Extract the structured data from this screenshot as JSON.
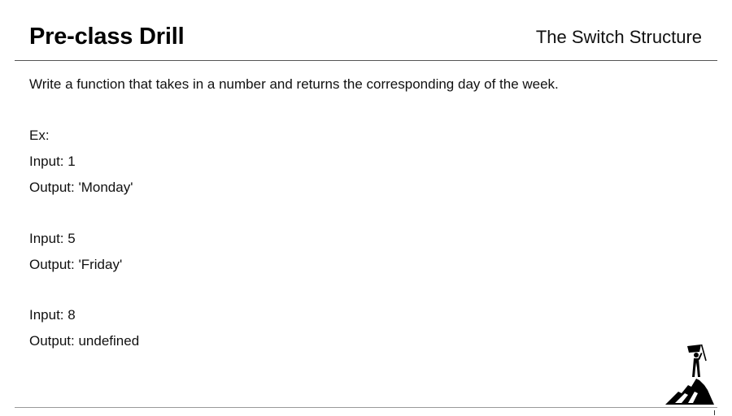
{
  "slide": {
    "title": "Pre-class Drill",
    "section": "The Switch Structure"
  },
  "prompt": "Write a function that takes in a number and returns the corresponding day of the week.",
  "example": {
    "label": "Ex:",
    "cases": [
      {
        "input": "Input: 1",
        "output": "Output: 'Monday'"
      },
      {
        "input": "Input: 5",
        "output": "Output: 'Friday'"
      },
      {
        "input": "Input: 8",
        "output": "Output: undefined"
      }
    ]
  },
  "logo": {
    "icon": "summit-flag-logo-icon",
    "color": "#000000"
  }
}
